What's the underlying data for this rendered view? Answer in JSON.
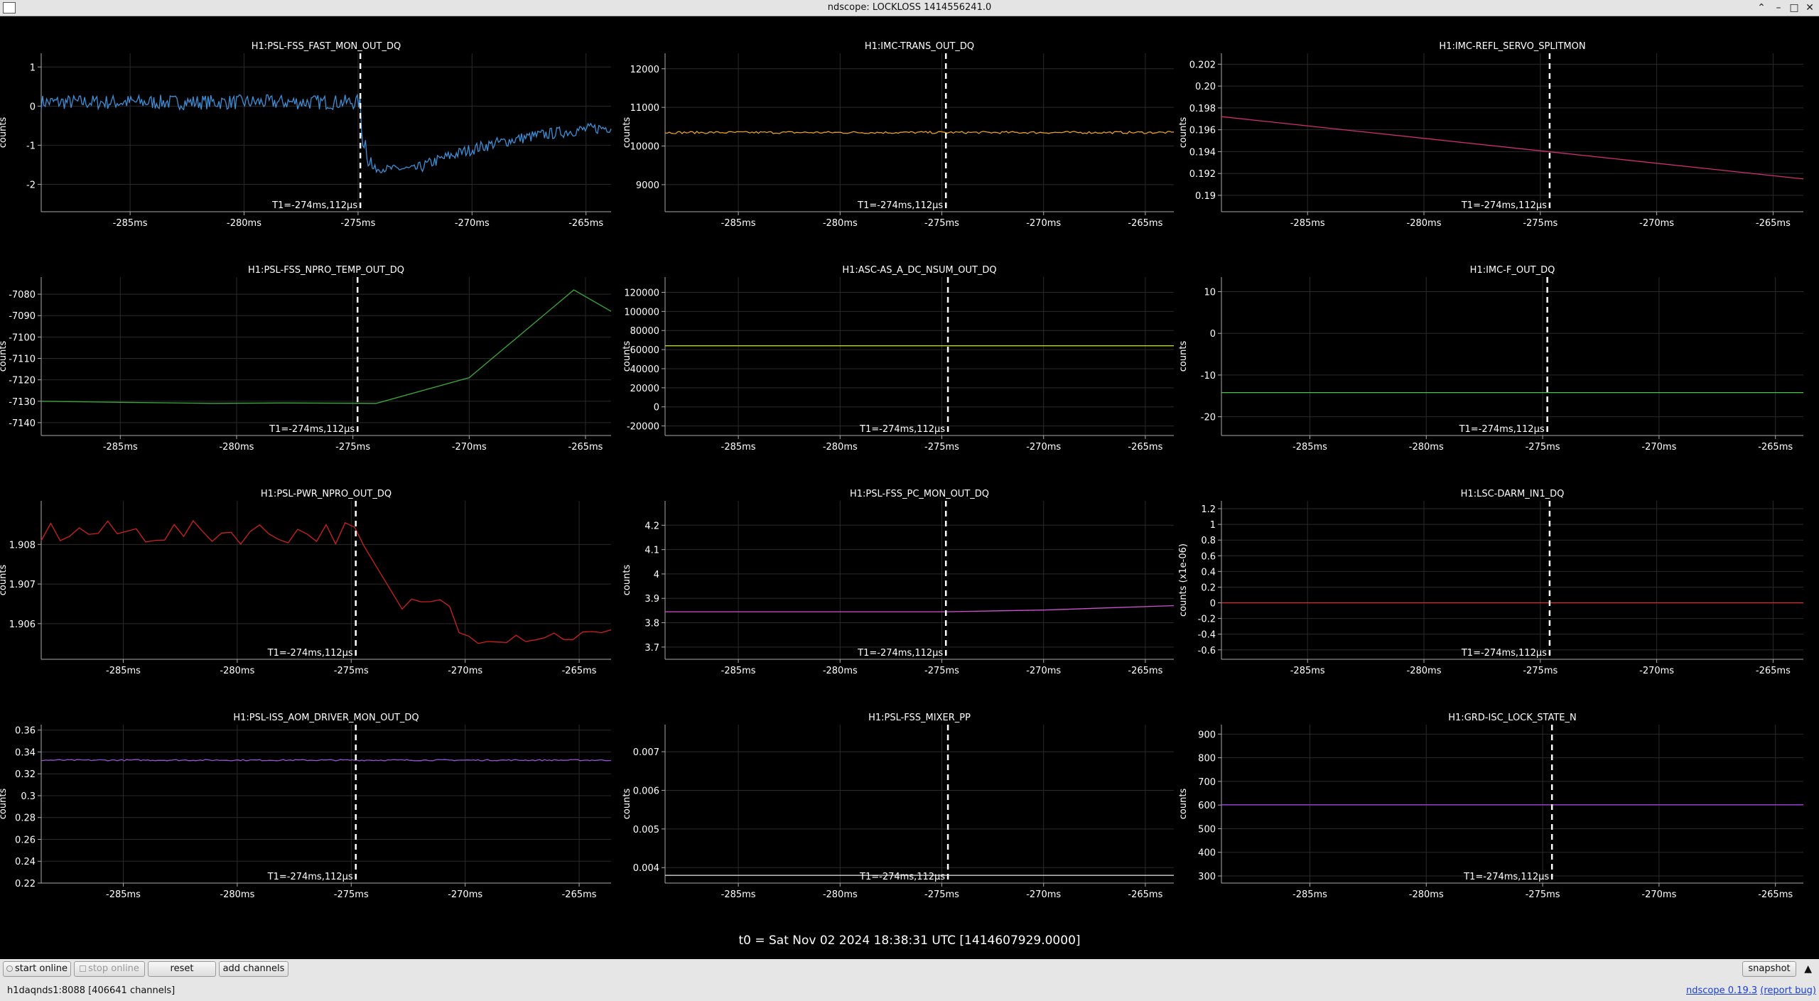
{
  "window": {
    "title": "ndscope: LOCKLOSS 1414556241.0"
  },
  "t0_label": "t0 = Sat Nov 02 2024 18:38:31 UTC [1414607929.0000]",
  "cursor_label": "T1=-274ms,112µs",
  "x_ticks": [
    {
      "v": -285,
      "label": "-285ms"
    },
    {
      "v": -280,
      "label": "-280ms"
    },
    {
      "v": -275,
      "label": "-275ms"
    },
    {
      "v": -270,
      "label": "-270ms"
    },
    {
      "v": -265,
      "label": "-265ms"
    }
  ],
  "chart_data": [
    {
      "type": "line",
      "title": "H1:PSL-FSS_FAST_MON_OUT_DQ",
      "ylabel": "counts",
      "color": "#3d8fd8",
      "xlim": [
        -288.9,
        -263.9
      ],
      "ylim": [
        -2.7,
        1.35
      ],
      "cursor_x": -274.9,
      "yticks": [
        {
          "v": 1,
          "label": "1"
        },
        {
          "v": 0,
          "label": "0"
        },
        {
          "v": -1,
          "label": "-1"
        },
        {
          "v": -2,
          "label": "-2"
        }
      ],
      "gen": {
        "kind": "fast_mon"
      }
    },
    {
      "type": "line",
      "title": "H1:IMC-TRANS_OUT_DQ",
      "ylabel": "counts",
      "color": "#e8a020",
      "xlim": [
        -288.6,
        -263.6
      ],
      "ylim": [
        8300,
        12400
      ],
      "cursor_x": -274.8,
      "yticks": [
        {
          "v": 12000,
          "label": "12000"
        },
        {
          "v": 11000,
          "label": "11000"
        },
        {
          "v": 10000,
          "label": "10000"
        },
        {
          "v": 9000,
          "label": "9000"
        }
      ],
      "gen": {
        "kind": "flat_noise",
        "base": 10350,
        "amp": 30
      }
    },
    {
      "type": "line",
      "title": "H1:IMC-REFL_SERVO_SPLITMON",
      "ylabel": "counts",
      "color": "#d03070",
      "xlim": [
        -288.7,
        -263.7
      ],
      "ylim": [
        0.1885,
        0.203
      ],
      "cursor_x": -274.6,
      "yticks": [
        {
          "v": 0.202,
          "label": "0.202"
        },
        {
          "v": 0.2,
          "label": "0.20"
        },
        {
          "v": 0.198,
          "label": "0.198"
        },
        {
          "v": 0.196,
          "label": "0.196"
        },
        {
          "v": 0.194,
          "label": "0.194"
        },
        {
          "v": 0.192,
          "label": "0.192"
        },
        {
          "v": 0.19,
          "label": "0.19"
        }
      ],
      "x": [
        -288.7,
        -263.7
      ],
      "y": [
        0.1972,
        0.1915
      ]
    },
    {
      "type": "line",
      "title": "H1:PSL-FSS_NPRO_TEMP_OUT_DQ",
      "ylabel": "counts",
      "color": "#3aa83a",
      "xlim": [
        -288.4,
        -263.9
      ],
      "ylim": [
        -7146,
        -7072
      ],
      "cursor_x": -274.8,
      "yticks": [
        {
          "v": -7080,
          "label": "-7080"
        },
        {
          "v": -7090,
          "label": "-7090"
        },
        {
          "v": -7100,
          "label": "-7100"
        },
        {
          "v": -7110,
          "label": "-7110"
        },
        {
          "v": -7120,
          "label": "-7120"
        },
        {
          "v": -7130,
          "label": "-7130"
        },
        {
          "v": -7140,
          "label": "-7140"
        }
      ],
      "x": [
        -288.4,
        -285.0,
        -281.0,
        -278.0,
        -274.0,
        -270.0,
        -265.5,
        -263.9
      ],
      "y": [
        -7130,
        -7130.5,
        -7131,
        -7130.8,
        -7131,
        -7119,
        -7078,
        -7088
      ]
    },
    {
      "type": "line",
      "title": "H1:ASC-AS_A_DC_NSUM_OUT_DQ",
      "ylabel": "counts",
      "color": "#b8d820",
      "xlim": [
        -288.6,
        -263.6
      ],
      "ylim": [
        -30000,
        136000
      ],
      "cursor_x": -274.7,
      "yticks": [
        {
          "v": 120000,
          "label": "120000"
        },
        {
          "v": 100000,
          "label": "100000"
        },
        {
          "v": 80000,
          "label": "80000"
        },
        {
          "v": 60000,
          "label": "60000"
        },
        {
          "v": 40000,
          "label": "40000"
        },
        {
          "v": 20000,
          "label": "20000"
        },
        {
          "v": 0,
          "label": "0"
        },
        {
          "v": -20000,
          "label": "-20000"
        }
      ],
      "x": [
        -288.6,
        -263.6
      ],
      "y": [
        64000,
        64000
      ]
    },
    {
      "type": "line",
      "title": "H1:IMC-F_OUT_DQ",
      "ylabel": "counts",
      "color": "#48c848",
      "xlim": [
        -288.8,
        -263.8
      ],
      "ylim": [
        -24.5,
        13.5
      ],
      "cursor_x": -274.8,
      "yticks": [
        {
          "v": 10,
          "label": "10"
        },
        {
          "v": 0,
          "label": "0"
        },
        {
          "v": -10,
          "label": "-10"
        },
        {
          "v": -20,
          "label": "-20"
        }
      ],
      "x": [
        -288.8,
        -263.8
      ],
      "y": [
        -14.2,
        -14.2
      ]
    },
    {
      "type": "line",
      "title": "H1:PSL-PWR_NPRO_OUT_DQ",
      "ylabel": "counts",
      "color": "#d02020",
      "xlim": [
        -288.6,
        -263.6
      ],
      "ylim": [
        1.9051,
        1.9091
      ],
      "cursor_x": -274.8,
      "yticks": [
        {
          "v": 1.908,
          "label": "1.908"
        },
        {
          "v": 1.907,
          "label": "1.907"
        },
        {
          "v": 1.906,
          "label": "1.906"
        }
      ],
      "gen": {
        "kind": "npro_pwr"
      }
    },
    {
      "type": "line",
      "title": "H1:PSL-FSS_PC_MON_OUT_DQ",
      "ylabel": "counts",
      "color": "#d050d0",
      "xlim": [
        -288.6,
        -263.6
      ],
      "ylim": [
        3.65,
        4.3
      ],
      "cursor_x": -274.8,
      "yticks": [
        {
          "v": 4.2,
          "label": "4.2"
        },
        {
          "v": 4.1,
          "label": "4.1"
        },
        {
          "v": 4,
          "label": "4"
        },
        {
          "v": 3.9,
          "label": "3.9"
        },
        {
          "v": 3.8,
          "label": "3.8"
        },
        {
          "v": 3.7,
          "label": "3.7"
        }
      ],
      "x": [
        -288.6,
        -274.8,
        -270.0,
        -263.6
      ],
      "y": [
        3.845,
        3.845,
        3.852,
        3.87
      ]
    },
    {
      "type": "line",
      "title": "H1:LSC-DARM_IN1_DQ",
      "ylabel": "counts (x1e-06)",
      "color": "#e03030",
      "xlim": [
        -288.7,
        -263.7
      ],
      "ylim": [
        -0.72,
        1.3
      ],
      "cursor_x": -274.6,
      "yticks": [
        {
          "v": 1.2,
          "label": "1.2"
        },
        {
          "v": 1,
          "label": "1"
        },
        {
          "v": 0.8,
          "label": "0.8"
        },
        {
          "v": 0.6,
          "label": "0.6"
        },
        {
          "v": 0.4,
          "label": "0.4"
        },
        {
          "v": 0.2,
          "label": "0.2"
        },
        {
          "v": 0,
          "label": "0"
        },
        {
          "v": -0.2,
          "label": "-0.2"
        },
        {
          "v": -0.4,
          "label": "-0.4"
        },
        {
          "v": -0.6,
          "label": "-0.6"
        }
      ],
      "x": [
        -288.7,
        -263.7
      ],
      "y": [
        0,
        0
      ]
    },
    {
      "type": "line",
      "title": "H1:PSL-ISS_AOM_DRIVER_MON_OUT_DQ",
      "ylabel": "counts",
      "color": "#9a50d8",
      "xlim": [
        -288.6,
        -263.6
      ],
      "ylim": [
        0.22,
        0.365
      ],
      "cursor_x": -274.8,
      "yticks": [
        {
          "v": 0.36,
          "label": "0.36"
        },
        {
          "v": 0.34,
          "label": "0.34"
        },
        {
          "v": 0.32,
          "label": "0.32"
        },
        {
          "v": 0.3,
          "label": "0.3"
        },
        {
          "v": 0.28,
          "label": "0.28"
        },
        {
          "v": 0.26,
          "label": "0.26"
        },
        {
          "v": 0.24,
          "label": "0.24"
        },
        {
          "v": 0.22,
          "label": "0.22"
        }
      ],
      "gen": {
        "kind": "flat_noise",
        "base": 0.3325,
        "amp": 0.0006
      }
    },
    {
      "type": "line",
      "title": "H1:PSL-FSS_MIXER_PP",
      "ylabel": "counts",
      "color": "#e8e8e8",
      "xlim": [
        -288.6,
        -263.6
      ],
      "ylim": [
        0.0036,
        0.0077
      ],
      "cursor_x": -274.7,
      "yticks": [
        {
          "v": 0.007,
          "label": "0.007"
        },
        {
          "v": 0.006,
          "label": "0.006"
        },
        {
          "v": 0.005,
          "label": "0.005"
        },
        {
          "v": 0.004,
          "label": "0.004"
        }
      ],
      "x": [
        -288.6,
        -278.8,
        -278.8,
        -263.6
      ],
      "y": [
        0.0038,
        0.0038,
        0.0038,
        0.0038
      ]
    },
    {
      "type": "line",
      "title": "H1:GRD-ISC_LOCK_STATE_N",
      "ylabel": "counts",
      "color": "#a040e0",
      "xlim": [
        -288.8,
        -263.8
      ],
      "ylim": [
        270,
        940
      ],
      "cursor_x": -274.6,
      "yticks": [
        {
          "v": 900,
          "label": "900"
        },
        {
          "v": 800,
          "label": "800"
        },
        {
          "v": 700,
          "label": "700"
        },
        {
          "v": 600,
          "label": "600"
        },
        {
          "v": 500,
          "label": "500"
        },
        {
          "v": 400,
          "label": "400"
        },
        {
          "v": 300,
          "label": "300"
        }
      ],
      "x": [
        -288.8,
        -263.8
      ],
      "y": [
        601,
        601
      ]
    }
  ],
  "buttons": {
    "start_online": "start online",
    "stop_online": "stop online",
    "reset": "reset",
    "add_channels": "add channels",
    "snapshot": "snapshot"
  },
  "status": "h1daqnds1:8088  [406641 channels]",
  "version": {
    "name": "ndscope",
    "number": "0.19.3",
    "report": "(report bug)"
  },
  "icons": [
    "app-icon",
    "chevron-up-icon",
    "minimize-icon",
    "maximize-icon",
    "close-icon",
    "collapse-up-icon"
  ]
}
